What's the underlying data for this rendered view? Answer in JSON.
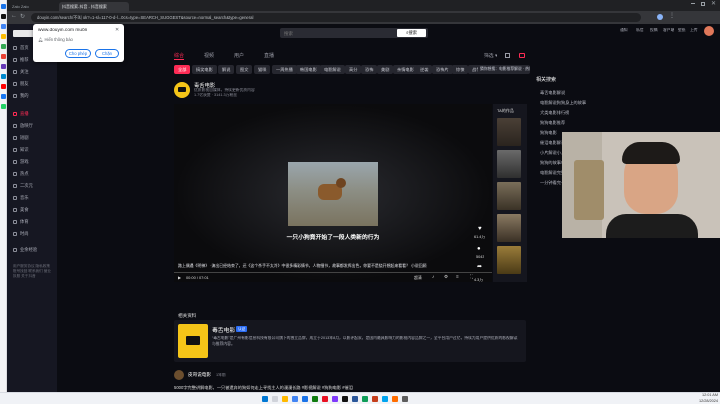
{
  "browser": {
    "tab_title": "抖音搜索-抖音 - 抖音搜索",
    "url": "douyin.com/search/不叫 ok?=1-sl=117-0-d-l...0cs=type=SEARCH_SUGGEST&source=normal_search&type=general",
    "left_app_label": "Zalo Zalo"
  },
  "permission_popup": {
    "site": "www.douyin.com muốn",
    "request": "Hiển thông báo",
    "allow_label": "Cho phép",
    "block_label": "Chặn"
  },
  "search": {
    "placeholder": "搜索",
    "button_label": "搜索"
  },
  "header_right": {
    "items": [
      "通知",
      "私信",
      "投稿",
      "客户端",
      "壁纸",
      "上传"
    ]
  },
  "tabs": [
    {
      "label": "综合",
      "active": true
    },
    {
      "label": "视频",
      "active": false
    },
    {
      "label": "用户",
      "active": false
    },
    {
      "label": "直播",
      "active": false
    }
  ],
  "filter_label": "筛选",
  "chips": [
    "全部",
    "搞笑电影",
    "解说",
    "图文",
    "猫咪",
    "一周热播",
    "韩国电影",
    "电影解说",
    "高分",
    "恐怖",
    "美剧",
    "亲情电影",
    "逆袭",
    "恐怖片",
    "惊悚",
    "战争片"
  ],
  "suggest_banner": "猜你想搜：电影推荐解说 · 热门电影 · 热度最高",
  "author": {
    "name": "毒舌电影",
    "bio": "优质影视自媒体，持续更新优质内容",
    "stats": "1.7亿获赞 · 3141.3万粉丝"
  },
  "video": {
    "subtitle": "一只小狗竟开始了一段人类新的行为",
    "caption": "路上偶遇《明神》 ·演出已经结束了，还《这个杀手不太冷》中很多精彩情节，人物细节，故事都发挥出色，你要不是绕开想起来看看？ 小说回顾",
    "time": "00:00 / 07:01",
    "hd_label": "超清"
  },
  "video_actions": [
    {
      "icon": "heart-icon",
      "count": "61.4万"
    },
    {
      "icon": "comment-icon",
      "count": "5043"
    },
    {
      "icon": "share-icon",
      "count": "4.3万"
    }
  ],
  "rail": {
    "heading": "TA的作品"
  },
  "right_panel": {
    "heading": "相关搜索",
    "items": [
      "毒舌电影解说",
      "电影解说狗狗身上的故事",
      "犬类电影排行榜",
      "狗狗电影推荐",
      "狗狗电影",
      "催泪电影解说",
      "小片解说小人物",
      "狗狗的故事电影推荐",
      "电影解说完整版",
      "一分钟看完一部电影",
      "宠物电影",
      "狗狗与人感动故事"
    ]
  },
  "related": {
    "heading": "相关资料",
    "name": "毒舌电影",
    "badge": "认证",
    "description": "“毒舌电影”是广州有影信息科技有限公司旗下的独立品牌，成立于2013年8月，以影评起家，是国内最具影响力的影视内容品牌之一，全平台用户过亿，持续为用户提供优质的影视解读与推荐内容。"
  },
  "next_post": {
    "author": "皮哥说电影",
    "time": "1年前",
    "text": "5000字完整讲解电影，一只被遗弃的狗如何走上寻找主人的漫漫长路 #影视解说 #狗狗电影 #催泪"
  },
  "sidebar": {
    "items": [
      "首页",
      "推荐",
      "关注",
      "朋友",
      "我的",
      "直播",
      "放映厅",
      "短剧",
      "知识",
      "游戏",
      "热点",
      "二次元",
      "音乐",
      "美食",
      "体育",
      "时尚",
      "业余经验"
    ],
    "footer": "用户服务协议 隐私政策 账号找回 联系我们 营业执照 关于抖音"
  },
  "taskbar": {
    "time": "12:01 AM",
    "date": "12/28/2024"
  },
  "colors": {
    "accent": "#fe2c55",
    "page_bg": "#0b0c12",
    "sidebar_bg": "#161722"
  }
}
